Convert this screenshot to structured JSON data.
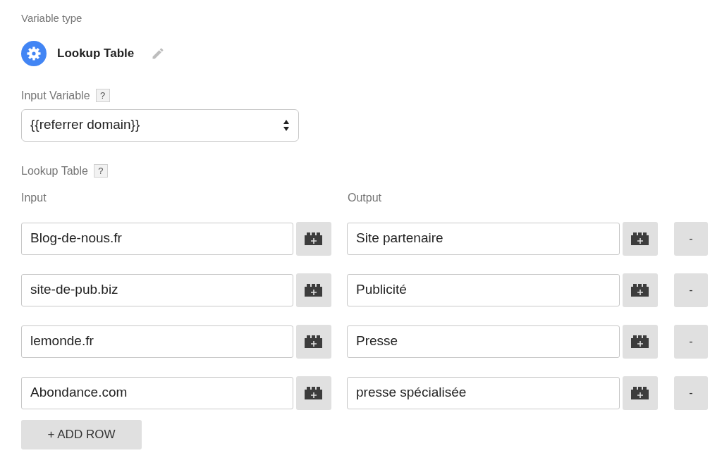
{
  "variable_type": {
    "label": "Variable type",
    "name": "Lookup Table"
  },
  "input_variable": {
    "label": "Input Variable",
    "help": "?",
    "value": "{{referrer domain}}"
  },
  "lookup_table": {
    "label": "Lookup Table",
    "help": "?",
    "columns": [
      "Input",
      "Output"
    ],
    "rows": [
      {
        "input": "Blog-de-nous.fr",
        "output": "Site partenaire",
        "remove": "-"
      },
      {
        "input": "site-de-pub.biz",
        "output": "Publicité",
        "remove": "-"
      },
      {
        "input": "lemonde.fr",
        "output": "Presse",
        "remove": "-"
      },
      {
        "input": "Abondance.com",
        "output": "presse spécialisée",
        "remove": "-"
      }
    ],
    "add_row": "+ ADD ROW"
  }
}
